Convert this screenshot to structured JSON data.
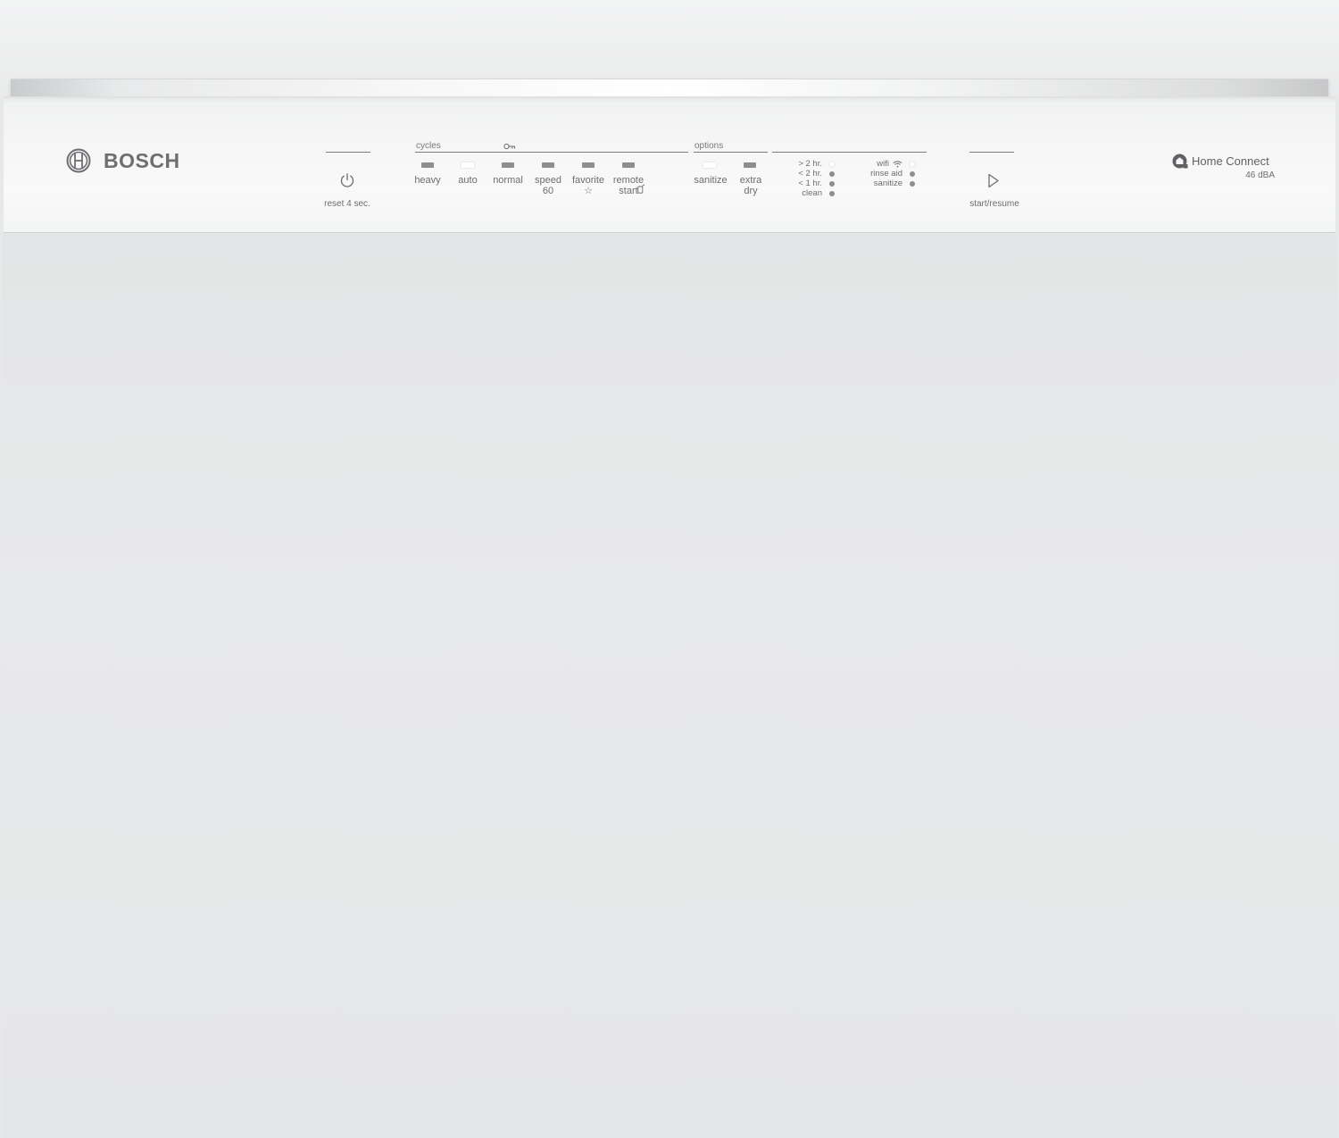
{
  "brand": {
    "name": "BOSCH"
  },
  "power": {
    "label": "reset 4 sec."
  },
  "cycles": {
    "label": "cycles",
    "buttons": [
      {
        "line1": "heavy",
        "line2": "",
        "lit": false
      },
      {
        "line1": "auto",
        "line2": "",
        "lit": true
      },
      {
        "line1": "normal",
        "line2": "",
        "lit": false
      },
      {
        "line1": "speed",
        "line2": "60",
        "lit": false
      },
      {
        "line1": "favorite",
        "line2": "☆",
        "lit": false
      },
      {
        "line1": "remote",
        "line2": "start",
        "lit": false
      }
    ]
  },
  "options": {
    "label": "options",
    "buttons": [
      {
        "line1": "sanitize",
        "line2": "",
        "lit": true
      },
      {
        "line1": "extra",
        "line2": "dry",
        "lit": false
      }
    ]
  },
  "time_remaining": [
    {
      "label": "> 2 hr.",
      "lit": true
    },
    {
      "label": "< 2 hr.",
      "lit": false
    },
    {
      "label": "< 1 hr.",
      "lit": false
    },
    {
      "label": "clean",
      "lit": false
    }
  ],
  "indicators": [
    {
      "label": "wifi",
      "lit": true
    },
    {
      "label": "rinse aid",
      "lit": false
    },
    {
      "label": "sanitize",
      "lit": false
    }
  ],
  "start": {
    "label": "start/resume"
  },
  "home_connect": {
    "label": "Home Connect",
    "noise": "46 dBA"
  },
  "icons": {
    "brand": "bosch-armature-icon",
    "power": "power-icon",
    "lock": "child-lock-icon",
    "play": "play-icon",
    "wifi": "wifi-icon",
    "remote": "remote-start-icon",
    "home_connect": "home-connect-icon"
  }
}
